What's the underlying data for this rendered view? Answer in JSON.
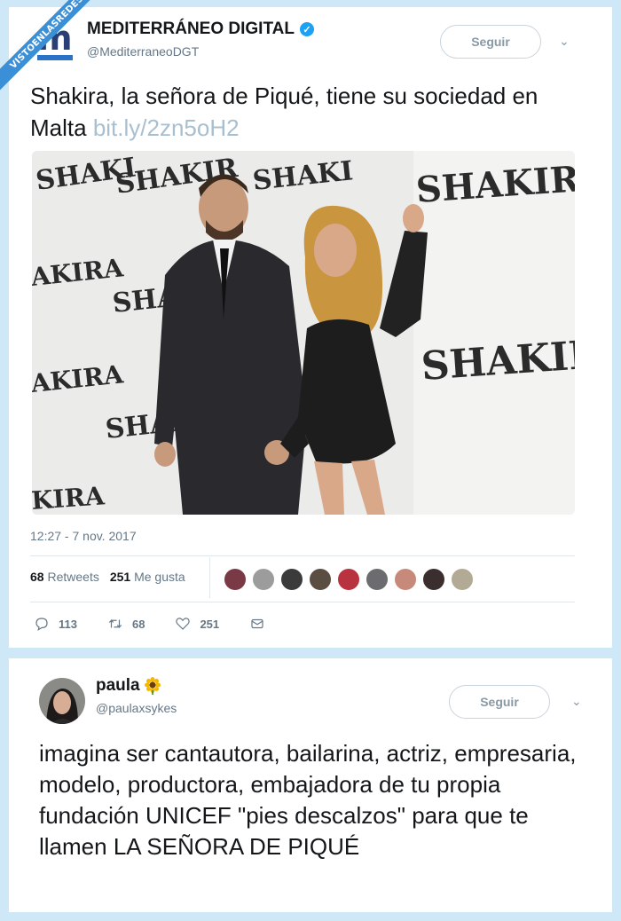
{
  "watermark": {
    "text": "VISTOENLASREDES"
  },
  "tweet1": {
    "display_name": "MEDITERRÁNEO DIGITAL",
    "handle": "@MediterraneoDGT",
    "follow_label": "Seguir",
    "text": "Shakira, la señora de Piqué, tiene su sociedad en Malta",
    "link": "bit.ly/2zn5oH2",
    "timestamp": "12:27 - 7 nov. 2017",
    "retweets_count": "68",
    "retweets_label": "Retweets",
    "likes_count": "251",
    "likes_label": "Me gusta",
    "photo_backdrop_lettering": "SHAKIRA",
    "reply_count": "113",
    "retweet_count_action": "68",
    "like_count_action": "251",
    "icons": [
      "verified-badge-icon",
      "chevron-down-icon",
      "reply-icon",
      "retweet-icon",
      "heart-icon",
      "envelope-icon"
    ],
    "liker_avatar_colors": [
      "#7a3a45",
      "#9c9c9c",
      "#3b3b3b",
      "#5a4d42",
      "#b8323f",
      "#6b6b70",
      "#c78a7a",
      "#3a2e2e",
      "#b3aa95"
    ]
  },
  "tweet2": {
    "display_name": "paula",
    "emoji": "sunflower-icon",
    "handle": "@paulaxsykes",
    "follow_label": "Seguir",
    "text": "imagina ser cantautora, bailarina, actriz, empresaria, modelo, productora, embajadora de tu propia fundación UNICEF \"pies descalzos\" para que te llamen LA SEÑORA DE PIQUÉ"
  },
  "colors": {
    "accent": "#1da1f2",
    "muted": "#657786",
    "link": "#a8bfcf",
    "background": "#cfe8f7"
  }
}
